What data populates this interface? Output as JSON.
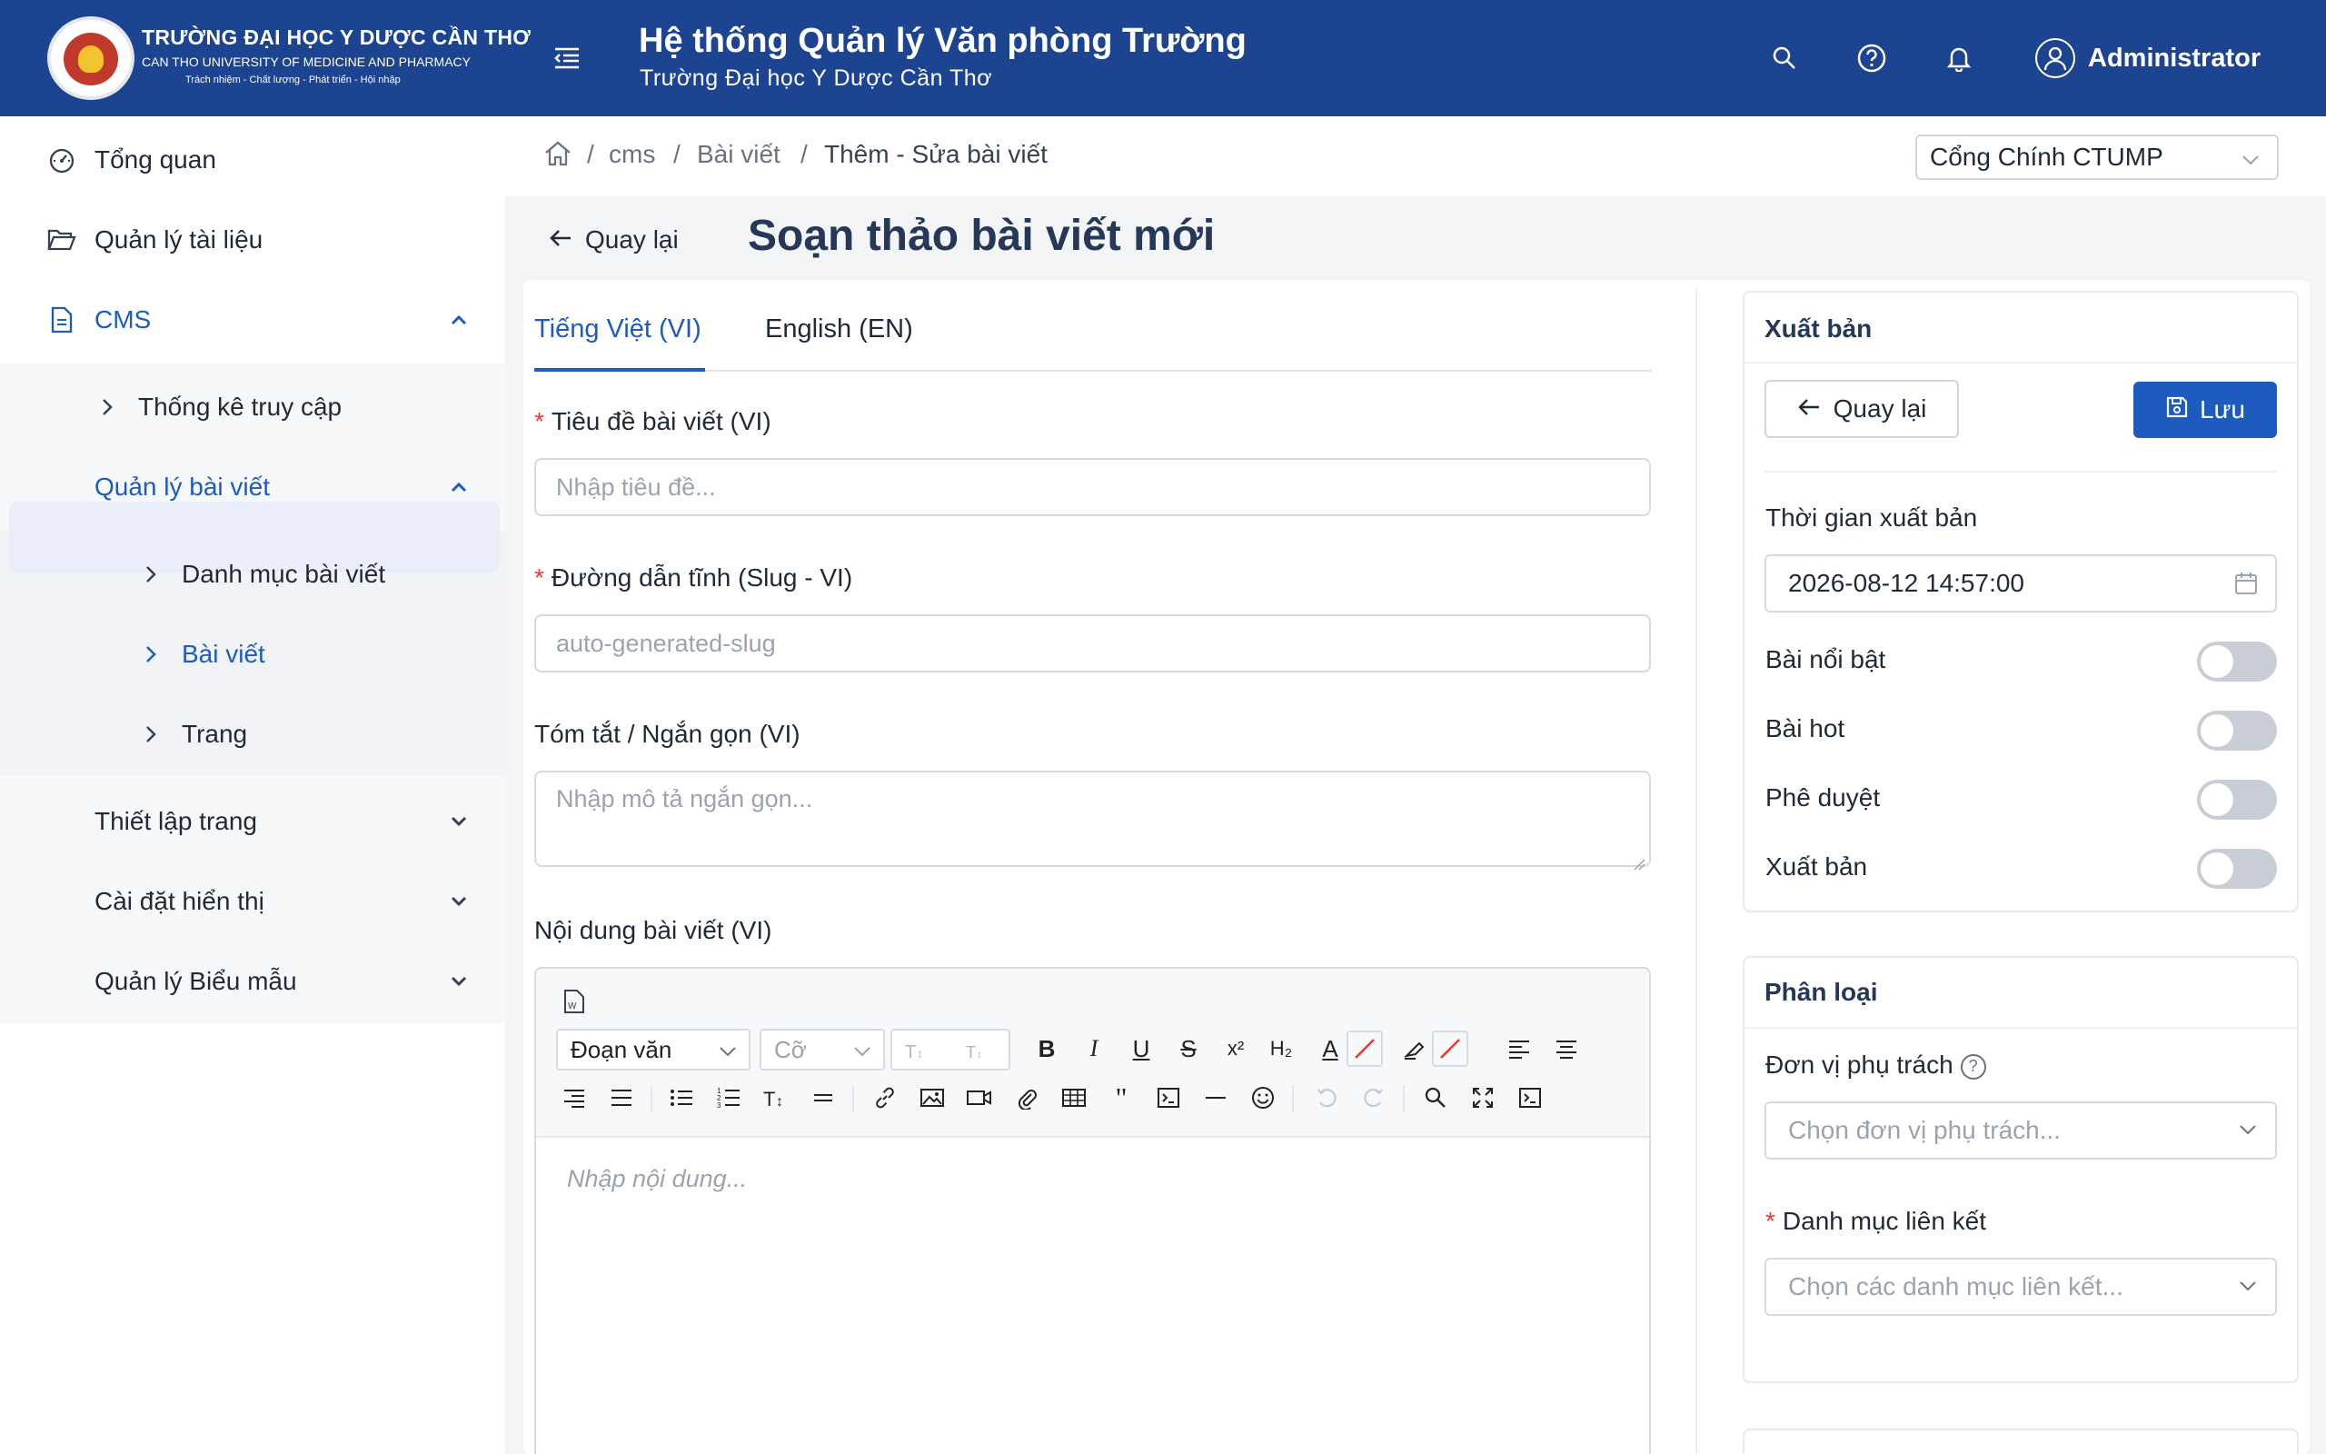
{
  "header": {
    "logo_name": "TRƯỜNG ĐẠI HỌC Y DƯỢC CẦN THƠ",
    "logo_english": "CAN THO UNIVERSITY OF MEDICINE AND PHARMACY",
    "logo_motto": "Trách nhiệm - Chất lượng - Phát triển - Hội nhập",
    "app_title": "Hệ thống Quản lý Văn phòng Trường",
    "app_subtitle": "Trường Đại học Y Dược Cần Thơ",
    "user_name": "Administrator",
    "brand_color": "#1d4490"
  },
  "sidebar": {
    "items": [
      {
        "label": "Tổng quan",
        "icon": "dashboard-icon"
      },
      {
        "label": "Quản lý tài liệu",
        "icon": "folder-open-icon"
      },
      {
        "label": "CMS",
        "icon": "document-icon"
      },
      {
        "label": "Thống kê truy cập"
      },
      {
        "label": "Quản lý bài viết"
      },
      {
        "label": "Danh mục bài viết"
      },
      {
        "label": "Bài viết"
      },
      {
        "label": "Trang"
      },
      {
        "label": "Thiết lập trang"
      },
      {
        "label": "Cài đặt hiển thị"
      },
      {
        "label": "Quản lý Biểu mẫu"
      }
    ]
  },
  "breadcrumb": {
    "items": [
      "cms",
      "Bài viết",
      "Thêm - Sửa bài viết"
    ],
    "separator": "/"
  },
  "portal_select": {
    "value": "Cổng Chính CTUMP"
  },
  "page": {
    "back_label": "Quay lại",
    "title": "Soạn thảo bài viết mới"
  },
  "tabs": {
    "vi": "Tiếng Việt (VI)",
    "en": "English (EN)"
  },
  "form": {
    "title_label": "Tiêu đề bài viết (VI)",
    "title_placeholder": "Nhập tiêu đề...",
    "slug_label": "Đường dẫn tĩnh (Slug - VI)",
    "slug_placeholder": "auto-generated-slug",
    "summary_label": "Tóm tắt / Ngắn gọn (VI)",
    "summary_placeholder": "Nhập mô tả ngắn gọn...",
    "content_label": "Nội dung bài viết (VI)",
    "required_mark": "*"
  },
  "editor": {
    "paragraph_select": "Đoạn văn",
    "size_select": "Cỡ",
    "placeholder": "Nhập nội dung...",
    "bold": "B",
    "italic": "I",
    "underline": "U",
    "strike": "S",
    "superscript": "x²",
    "subscript": "H₂",
    "font_color": "A",
    "quote": "\""
  },
  "publish": {
    "title": "Xuất bản",
    "back_label": "Quay lại",
    "save_label": "Lưu",
    "time_label": "Thời gian xuất bản",
    "time_value": "2026-08-12 14:57:00",
    "toggles": [
      {
        "label": "Bài nổi bật",
        "on": false
      },
      {
        "label": "Bài hot",
        "on": false
      },
      {
        "label": "Phê duyệt",
        "on": false
      },
      {
        "label": "Xuất bản",
        "on": false
      }
    ]
  },
  "classification": {
    "title": "Phân loại",
    "unit_label": "Đơn vị phụ trách",
    "unit_placeholder": "Chọn đơn vị phụ trách...",
    "category_label": "Danh mục liên kết",
    "category_placeholder": "Chọn các danh mục liên kết..."
  }
}
